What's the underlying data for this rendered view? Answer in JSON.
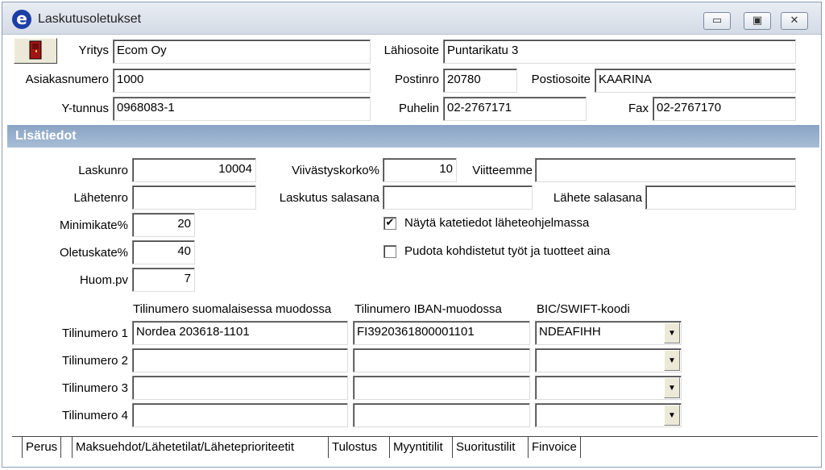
{
  "window": {
    "title": "Laskutusoletukset",
    "icon_letter": "e"
  },
  "titlebar_buttons": {
    "minimize": "▭",
    "maximize": "▣",
    "close": "✕"
  },
  "company": {
    "yritys_label": "Yritys",
    "yritys": "Ecom Oy",
    "asiakasnumero_label": "Asiakasnumero",
    "asiakasnumero": "1000",
    "ytunnus_label": "Y-tunnus",
    "ytunnus": "0968083-1",
    "lahiosoite_label": "Lähiosoite",
    "lahiosoite": "Puntarikatu 3",
    "postinro_label": "Postinro",
    "postinro": "20780",
    "postiosoite_label": "Postiosoite",
    "postiosoite": "KAARINA",
    "puhelin_label": "Puhelin",
    "puhelin": "02-2767171",
    "fax_label": "Fax",
    "fax": "02-2767170"
  },
  "section_title": "Lisätiedot",
  "extra": {
    "laskunro_label": "Laskunro",
    "laskunro": "10004",
    "lahetenro_label": "Lähetenro",
    "lahetenro": "",
    "minimikate_label": "Minimikate%",
    "minimikate": "20",
    "oletuskate_label": "Oletuskate%",
    "oletuskate": "40",
    "huompv_label": "Huom.pv",
    "huompv": "7",
    "viivastyskorko_label": "Viivästyskorko%",
    "viivastyskorko": "10",
    "viitteemme_label": "Viitteemme",
    "viitteemme": "",
    "laskutus_salasana_label": "Laskutus salasana",
    "laskutus_salasana": "",
    "lahete_salasana_label": "Lähete salasana",
    "lahete_salasana": "",
    "checkbox_katetiedot_label": "Näytä katetiedot läheteohjelmassa",
    "checkbox_katetiedot_checked": true,
    "checkbox_pudota_label": "Pudota kohdistetut työt ja tuotteet aina",
    "checkbox_pudota_checked": false
  },
  "accounts": {
    "col_domestic": "Tilinumero suomalaisessa muodossa",
    "col_iban": "Tilinumero IBAN-muodossa",
    "col_bic": "BIC/SWIFT-koodi",
    "rows": [
      {
        "label": "Tilinumero 1",
        "domestic": "Nordea 203618-1101",
        "iban": "FI3920361800001101",
        "bic": "NDEAFIHH"
      },
      {
        "label": "Tilinumero 2",
        "domestic": "",
        "iban": "",
        "bic": ""
      },
      {
        "label": "Tilinumero 3",
        "domestic": "",
        "iban": "",
        "bic": ""
      },
      {
        "label": "Tilinumero 4",
        "domestic": "",
        "iban": "",
        "bic": ""
      }
    ]
  },
  "tabs": [
    {
      "label": "Perus",
      "active": true
    },
    {
      "label": "Maksuehdot/Lähetetilat/Läheteprioriteetit",
      "active": false
    },
    {
      "label": "Tulostus",
      "active": false
    },
    {
      "label": "Myyntitilit",
      "active": false
    },
    {
      "label": "Suoritustilit",
      "active": false
    },
    {
      "label": "Finvoice",
      "active": false
    }
  ],
  "colors": {
    "section_header": "#9fb5d0",
    "title_bar": "#dde3ec",
    "face": "#ffffff"
  }
}
